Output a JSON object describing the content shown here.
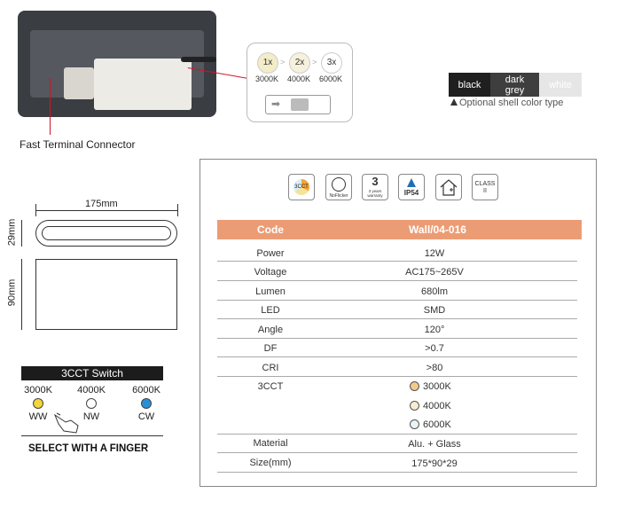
{
  "callout": {
    "label": "Fast Terminal Connector"
  },
  "switch_box": {
    "steps": [
      {
        "badge": "1x",
        "temp": "3000K",
        "color": "#f3ecc8"
      },
      {
        "badge": "2x",
        "temp": "4000K",
        "color": "#f6f1dc"
      },
      {
        "badge": "3x",
        "temp": "6000K",
        "color": "#ffffff"
      }
    ],
    "arrow": ">",
    "slider_arrow": "➡"
  },
  "shell": {
    "options": [
      {
        "label": "black",
        "bg": "#1f1f1f",
        "fg": "#ffffff"
      },
      {
        "label": "dark grey",
        "bg": "#3e3e3e",
        "fg": "#ffffff"
      },
      {
        "label": "white",
        "bg": "#e6e6e6",
        "fg": "#ffffff"
      }
    ],
    "note": "Optional shell color type"
  },
  "dimensions": {
    "width": "175mm",
    "depth": "29mm",
    "height": "90mm"
  },
  "cct_switch": {
    "title": "3CCT Switch",
    "options": [
      {
        "temp": "3000K",
        "code": "WW",
        "color": "#f2d63c"
      },
      {
        "temp": "4000K",
        "code": "NW",
        "color": "#ffffff"
      },
      {
        "temp": "6000K",
        "code": "CW",
        "color": "#2b8fd6"
      }
    ],
    "instruction": "SELECT WITH A FINGER"
  },
  "icons": [
    {
      "name": "3cct-icon",
      "text": "3CCT"
    },
    {
      "name": "no-flicker-icon",
      "text": "NoFlicker"
    },
    {
      "name": "warranty-icon",
      "text": "3 years warranty",
      "big": "3"
    },
    {
      "name": "ip54-icon",
      "text": "IP54"
    },
    {
      "name": "indoor-outdoor-icon",
      "text": ""
    },
    {
      "name": "class-ii-icon",
      "text": "CLASS II"
    }
  ],
  "spec": {
    "header": {
      "code_label": "Code",
      "code_value": "Wall/04-016"
    },
    "rows": [
      {
        "label": "Power",
        "value": "12W"
      },
      {
        "label": "Voltage",
        "value": "AC175~265V"
      },
      {
        "label": "Lumen",
        "value": "680lm"
      },
      {
        "label": "LED",
        "value": "SMD"
      },
      {
        "label": "Angle",
        "value": "120°"
      },
      {
        "label": "DF",
        "value": ">0.7"
      },
      {
        "label": "CRI",
        "value": ">80"
      }
    ],
    "cct_label": "3CCT",
    "cct_options": [
      {
        "value": "3000K",
        "color": "#f2c98a"
      },
      {
        "value": "4000K",
        "color": "#f6ecd2"
      },
      {
        "value": "6000K",
        "color": "#e9f3f8"
      }
    ],
    "rows_after": [
      {
        "label": "Material",
        "value": "Alu. + Glass"
      },
      {
        "label": "Size(mm)",
        "value": "175*90*29"
      }
    ]
  }
}
